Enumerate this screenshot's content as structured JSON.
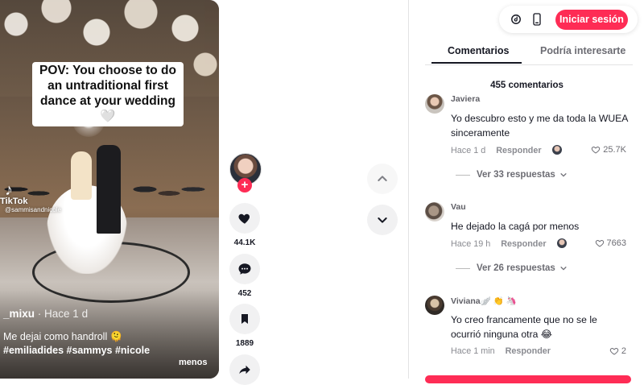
{
  "video": {
    "caption": "POV: You choose to do an untraditional first dance at your wedding 🤍",
    "watermark_logo": "TikTok",
    "watermark_handle": "@sammisandnicole",
    "author": "_mixu",
    "time": "· Hace 1 d",
    "description": "Me dejai como handroll 🫠",
    "hashtags": "#emiliadides #sammys #nicole",
    "more_label": "menos"
  },
  "actions": {
    "likes": "44.1K",
    "comments": "452",
    "saves": "1889"
  },
  "header": {
    "login_label": "Iniciar sesión"
  },
  "tabs": [
    {
      "label": "Comentarios"
    },
    {
      "label": "Podría interesarte"
    }
  ],
  "comment_count": "455 comentarios",
  "comments": [
    {
      "user": "Javiera",
      "text": "Yo descubro esto y me da toda la WUEA sinceramente",
      "time": "Hace 1 d",
      "reply_label": "Responder",
      "likes": "25.7K",
      "replies": "Ver 33 respuestas"
    },
    {
      "user": "Vau",
      "text": "He dejado la cagá por menos",
      "time": "Hace 19 h",
      "reply_label": "Responder",
      "likes": "7663",
      "replies": "Ver 26 respuestas"
    },
    {
      "user": "Viviana🪽 👏 🦄",
      "text": "Yo creo francamente que no se le ocurrió ninguna otra 😂",
      "time": "Hace 1 min",
      "reply_label": "Responder",
      "likes": "2"
    }
  ],
  "colors": {
    "accent": "#fe2c55",
    "text": "#161823",
    "muted": "#8a8b91",
    "button_bg": "#f1f1f2"
  }
}
